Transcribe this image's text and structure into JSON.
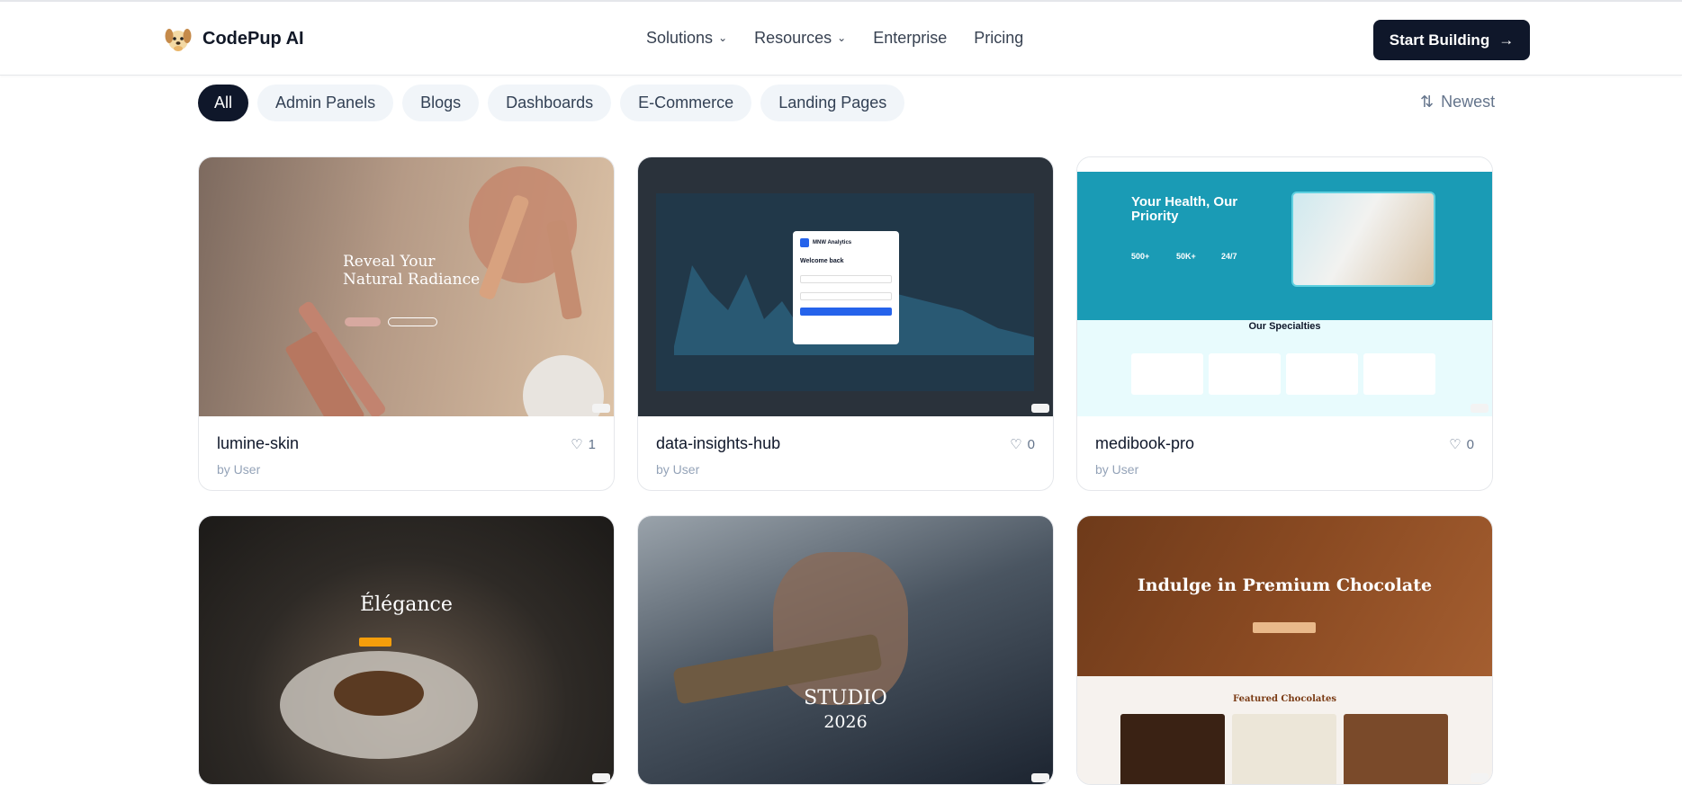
{
  "header": {
    "brand": "CodePup AI",
    "nav": [
      {
        "label": "Solutions",
        "dropdown": true
      },
      {
        "label": "Resources",
        "dropdown": true
      },
      {
        "label": "Enterprise",
        "dropdown": false
      },
      {
        "label": "Pricing",
        "dropdown": false
      }
    ],
    "cta_label": "Start Building"
  },
  "filters": [
    "All",
    "Admin Panels",
    "Blogs",
    "Dashboards",
    "E-Commerce",
    "Landing Pages"
  ],
  "active_filter": "All",
  "sort_label": "Newest",
  "cards": [
    {
      "name": "lumine-skin",
      "author": "by User",
      "likes": "1",
      "preview": {
        "headline1": "Reveal Your",
        "headline2": "Natural Radiance"
      }
    },
    {
      "name": "data-insights-hub",
      "author": "by User",
      "likes": "0",
      "preview": {
        "brand": "MNW Analytics",
        "title": "Welcome back"
      }
    },
    {
      "name": "medibook-pro",
      "author": "by User",
      "likes": "0",
      "preview": {
        "headline": "Your Health, Our Priority",
        "stat1": "500+",
        "stat2": "50K+",
        "stat3": "24/7",
        "section": "Our Specialties"
      }
    },
    {
      "name": "",
      "author": "",
      "likes": "",
      "preview": {
        "headline": "Élégance"
      }
    },
    {
      "name": "",
      "author": "",
      "likes": "",
      "preview": {
        "headline1": "STUDIO",
        "headline2": "2026"
      }
    },
    {
      "name": "",
      "author": "",
      "likes": "",
      "preview": {
        "headline": "Indulge in Premium Chocolate",
        "section": "Featured Chocolates"
      }
    }
  ],
  "colors": {
    "primary": "#0f172a",
    "pill_bg": "#f1f5f9",
    "muted": "#94a3b8",
    "teal": "#1a9bb5",
    "chocolate": "#8a4a22"
  }
}
